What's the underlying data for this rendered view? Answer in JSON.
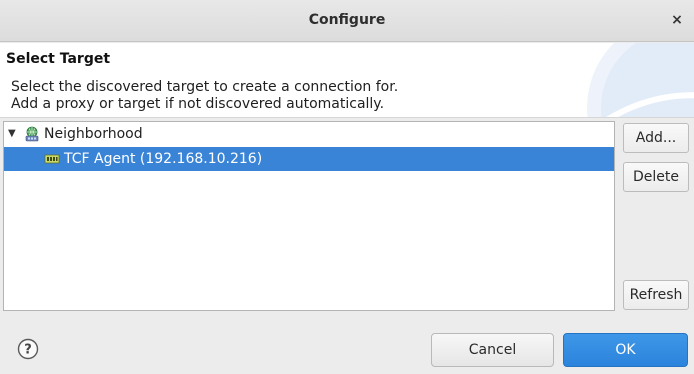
{
  "window": {
    "title": "Configure",
    "close_glyph": "×"
  },
  "banner": {
    "title": "Select Target",
    "desc_line1": "Select the discovered target to create a connection for.",
    "desc_line2": "Add a proxy or target if not discovered automatically."
  },
  "tree": {
    "items": [
      {
        "label": "Neighborhood",
        "expanded": true,
        "selected": false,
        "icon": "network-icon"
      },
      {
        "label": "TCF Agent (192.168.10.216)",
        "selected": true,
        "icon": "agent-icon"
      }
    ]
  },
  "side_buttons": {
    "add": "Add...",
    "delete": "Delete",
    "refresh": "Refresh"
  },
  "footer": {
    "help_glyph": "?",
    "cancel": "Cancel",
    "ok": "OK"
  },
  "colors": {
    "selection": "#3a84d8",
    "primary_button": "#2b84dc"
  }
}
